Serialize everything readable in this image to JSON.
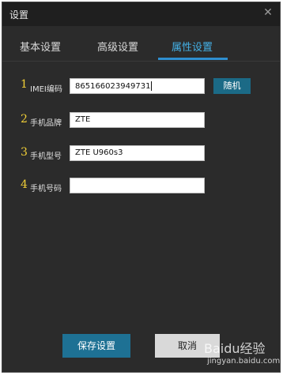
{
  "window": {
    "title": "设置"
  },
  "tabs": [
    "基本设置",
    "高级设置",
    "属性设置"
  ],
  "active_tab": "属性设置",
  "rows": [
    {
      "num": "1",
      "label": "IMEI编码",
      "value": "865166023949731"
    },
    {
      "num": "2",
      "label": "手机品牌",
      "value": "ZTE"
    },
    {
      "num": "3",
      "label": "手机型号",
      "value": "ZTE U960s3"
    },
    {
      "num": "4",
      "label": "手机号码",
      "value": ""
    }
  ],
  "buttons": {
    "random": "随机",
    "save": "保存设置",
    "cancel": "取消"
  },
  "watermark": {
    "text": "Baidu经验",
    "url": "jingyan.baidu.com"
  },
  "colors": {
    "accent": "#44b0e6",
    "number": "#f1cf37",
    "save": "#1e7194",
    "random": "#1b6a86"
  }
}
